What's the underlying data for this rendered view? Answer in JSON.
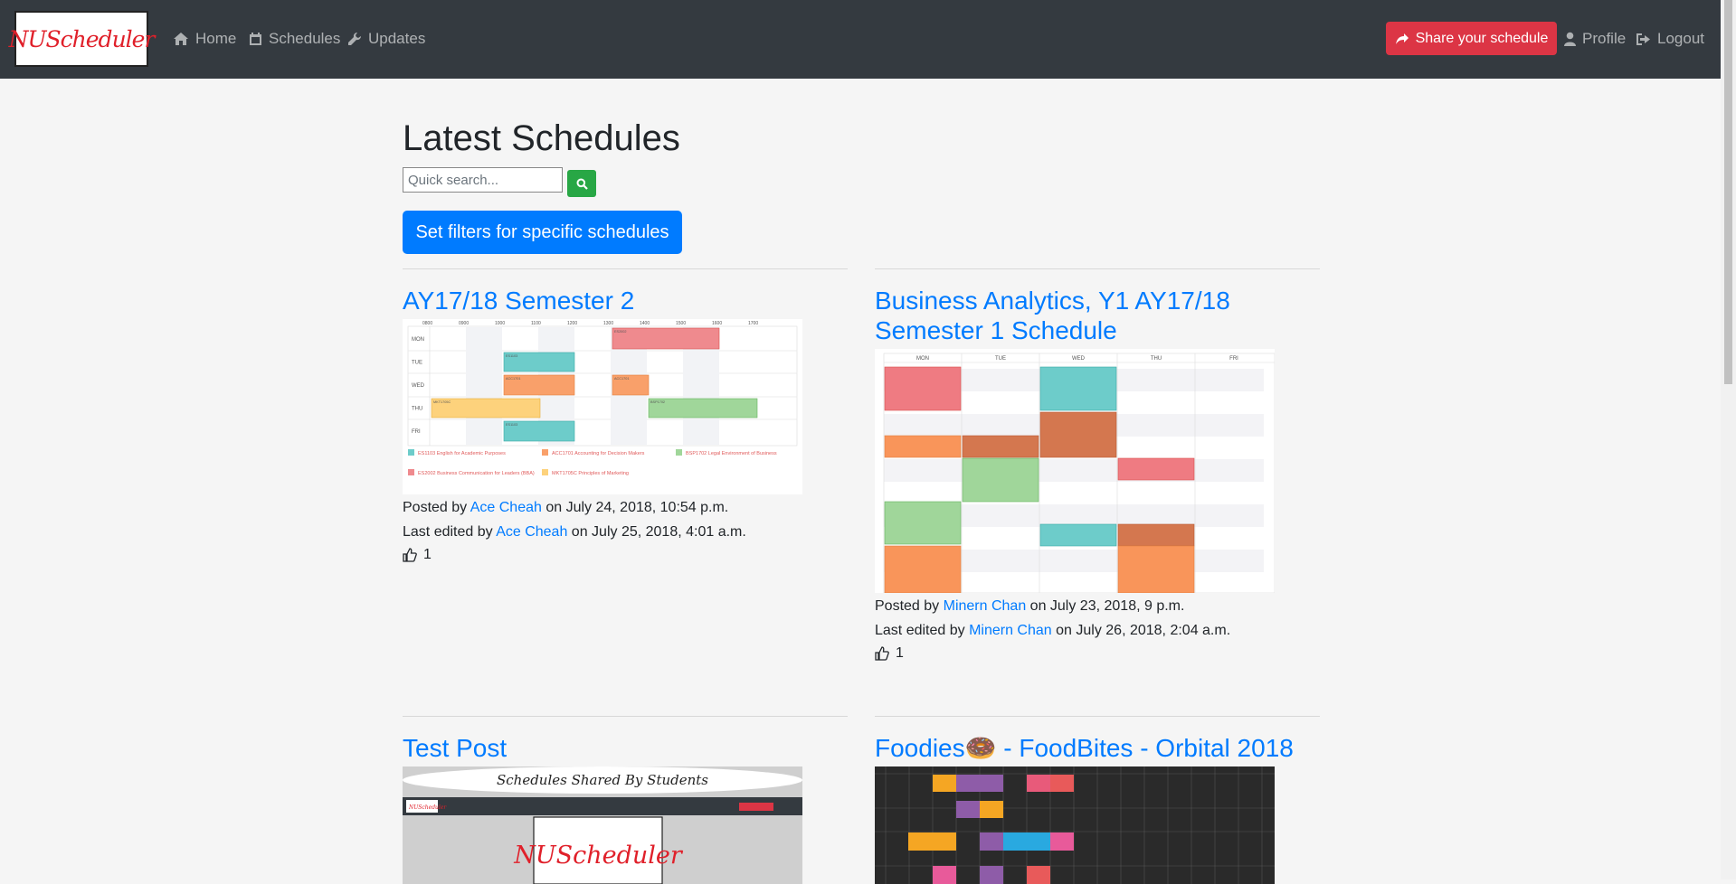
{
  "navbar": {
    "brand": "NUScheduler",
    "links": [
      {
        "label": "Home",
        "icon": "home-icon"
      },
      {
        "label": "Schedules",
        "icon": "calendar-icon"
      },
      {
        "label": "Updates",
        "icon": "wrench-icon"
      }
    ],
    "share_label": "Share your schedule",
    "profile_label": "Profile",
    "logout_label": "Logout"
  },
  "main": {
    "title": "Latest Schedules",
    "search_placeholder": "Quick search...",
    "filter_label": "Set filters for specific schedules"
  },
  "posts": [
    {
      "title": "AY17/18 Semester 2",
      "posted_prefix": "Posted by ",
      "posted_user": "Ace Cheah",
      "posted_date": " on July 24, 2018, 10:54 p.m.",
      "edited_prefix": "Last edited by ",
      "edited_user": "Ace Cheah",
      "edited_date": " on July 25, 2018, 4:01 a.m.",
      "likes": "1"
    },
    {
      "title": "Business Analytics, Y1 AY17/18 Semester 1 Schedule",
      "posted_prefix": "Posted by ",
      "posted_user": "Minern Chan",
      "posted_date": " on July 23, 2018, 9 p.m.",
      "edited_prefix": "Last edited by ",
      "edited_user": "Minern Chan",
      "edited_date": " on July 26, 2018, 2:04 a.m.",
      "likes": "1"
    },
    {
      "title": "Test Post",
      "thumb_caption": "Schedules Shared By Students",
      "thumb_brand": "NUScheduler"
    },
    {
      "title": "Foodies🍩 - FoodBites - Orbital 2018"
    }
  ],
  "thumb1": {
    "times": [
      "0800",
      "0900",
      "1000",
      "1100",
      "1200",
      "1300",
      "1400",
      "1500",
      "1600",
      "1700"
    ],
    "days": [
      "MON",
      "TUE",
      "WED",
      "THU",
      "FRI"
    ],
    "legend": [
      "ES1103 English for Academic Purposes",
      "ACC1701 Accounting for Decision Makers",
      "BSP1702 Legal Environment of Business",
      "ES2002 Business Communication for Leaders (BBA)",
      "MKT1705C Principles of Marketing"
    ]
  },
  "thumb2": {
    "days": [
      "MON",
      "TUE",
      "WED",
      "THU",
      "FRI"
    ]
  },
  "colors": {
    "navbar": "#343a40",
    "primary": "#007bff",
    "danger": "#dc3545",
    "success": "#28a745",
    "background": "#f5f5f5"
  }
}
